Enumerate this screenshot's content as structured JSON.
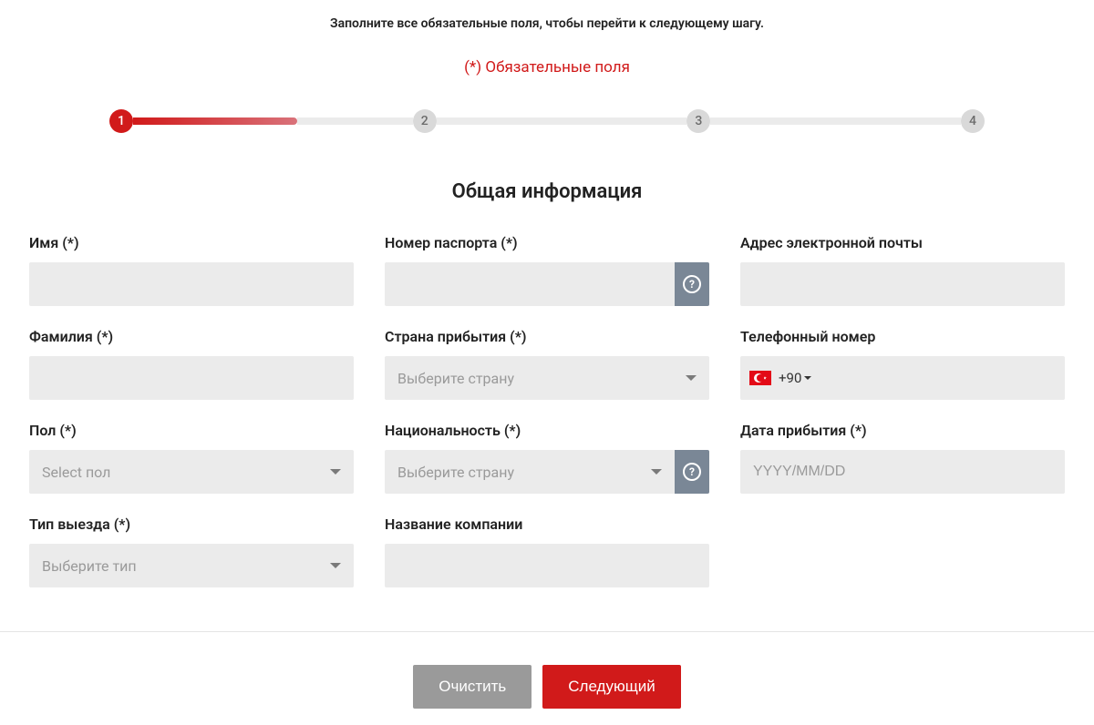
{
  "header": {
    "instruction": "Заполните все обязательные поля, чтобы перейти к следующему шагу.",
    "required_note": "(*) Обязательные поля"
  },
  "stepper": {
    "steps": [
      "1",
      "2",
      "3",
      "4"
    ],
    "active_index": 0
  },
  "section_title": "Общая информация",
  "fields": {
    "first_name": {
      "label": "Имя (*)"
    },
    "passport": {
      "label": "Номер паспорта (*)"
    },
    "email": {
      "label": "Адрес электронной почты"
    },
    "last_name": {
      "label": "Фамилия (*)"
    },
    "arrival_country": {
      "label": "Страна прибытия (*)",
      "placeholder": "Выберите страну"
    },
    "phone": {
      "label": "Телефонный номер",
      "dial_code": "+90"
    },
    "gender": {
      "label": "Пол (*)",
      "placeholder": "Select пол"
    },
    "nationality": {
      "label": "Национальность (*)",
      "placeholder": "Выберите страну"
    },
    "arrival_date": {
      "label": "Дата прибытия (*)",
      "placeholder": "YYYY/MM/DD"
    },
    "exit_type": {
      "label": "Тип выезда (*)",
      "placeholder": "Выберите тип"
    },
    "company": {
      "label": "Название компании"
    }
  },
  "buttons": {
    "clear": "Очистить",
    "next": "Следующий"
  }
}
